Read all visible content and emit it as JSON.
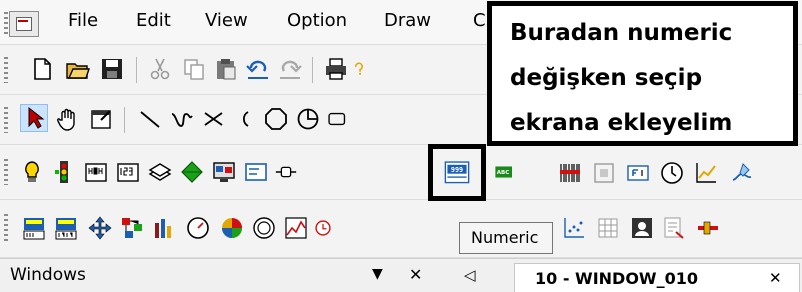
{
  "menu": {
    "file": "File",
    "edit": "Edit",
    "view": "View",
    "option": "Option",
    "draw": "Draw",
    "partial": "C"
  },
  "callout": {
    "line1": "Buradan numeric",
    "line2": "değişken seçip",
    "line3": "ekrana ekleyelim"
  },
  "numeric_icon": {
    "text": "999"
  },
  "next_icon": {
    "text": "ABC"
  },
  "tooltip": {
    "text": "Numeric"
  },
  "windows_panel": {
    "label": "Windows",
    "pin_glyph": "▼",
    "close_glyph": "✕",
    "back_glyph": "◁"
  },
  "tab": {
    "label": "10 - WINDOW_010",
    "close_glyph": "✕"
  },
  "colors": {
    "highlight_border": "#000000",
    "callout_bg": "#ffffff",
    "accent_red": "#d01010",
    "accent_blue": "#1a5fb4",
    "tab_bg": "#ffffff"
  }
}
